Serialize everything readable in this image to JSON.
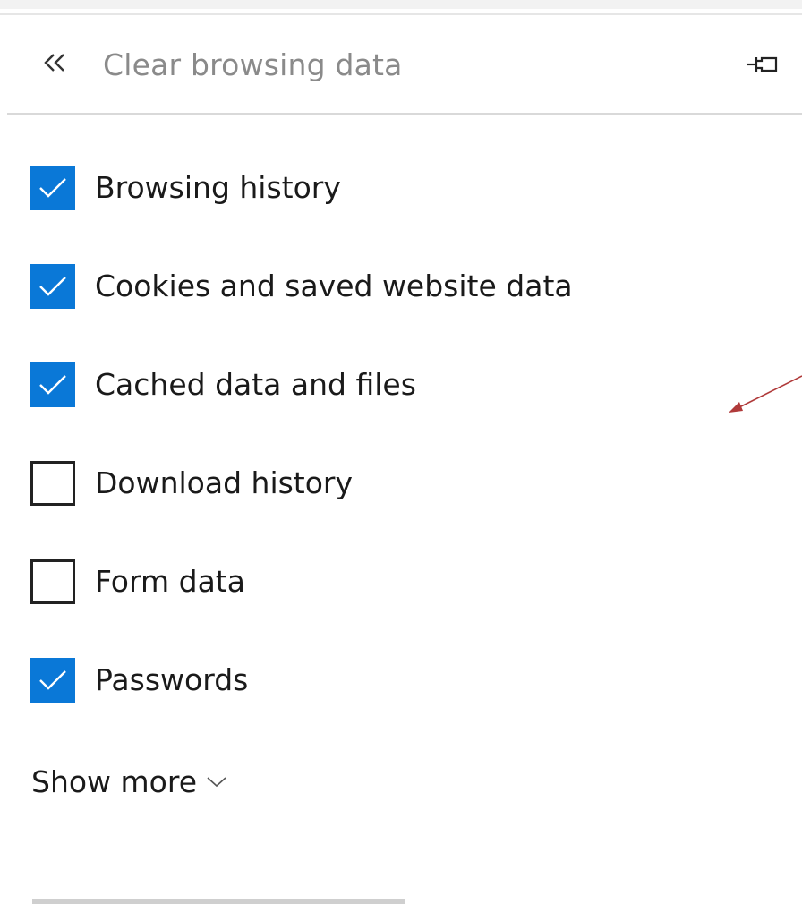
{
  "panel": {
    "title": "Clear browsing data",
    "back_icon": "double-chevron-left-icon",
    "pin_icon": "pin-icon"
  },
  "options": [
    {
      "label": "Browsing history",
      "checked": true
    },
    {
      "label": "Cookies and saved website data",
      "checked": true
    },
    {
      "label": "Cached data and files",
      "checked": true
    },
    {
      "label": "Download history",
      "checked": false
    },
    {
      "label": "Form data",
      "checked": false
    },
    {
      "label": "Passwords",
      "checked": true
    }
  ],
  "show_more": {
    "label": "Show more",
    "icon": "chevron-down-icon"
  },
  "colors": {
    "checkbox_checked": "#0a78d7",
    "annotation_arrow": "#b03a3a"
  }
}
